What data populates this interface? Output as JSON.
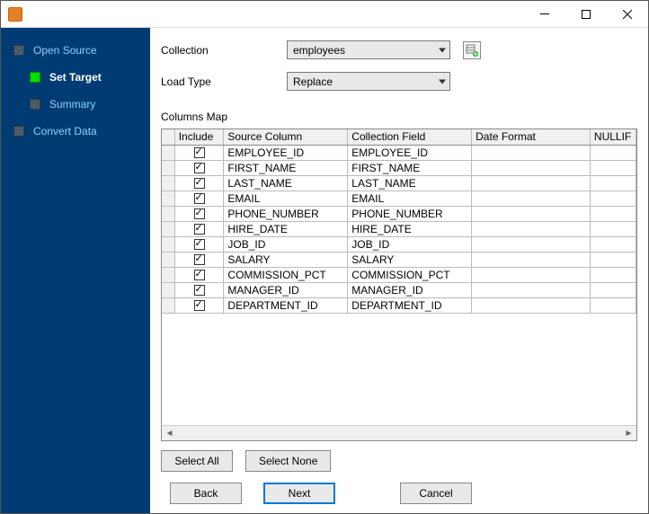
{
  "window": {
    "title": ""
  },
  "sidebar": {
    "steps": [
      {
        "label": "Open Source",
        "active": false,
        "sub": false
      },
      {
        "label": "Set Target",
        "active": true,
        "sub": true
      },
      {
        "label": "Summary",
        "active": false,
        "sub": true
      },
      {
        "label": "Convert Data",
        "active": false,
        "sub": false
      }
    ]
  },
  "form": {
    "collection_label": "Collection",
    "collection_value": "employees",
    "loadtype_label": "Load Type",
    "loadtype_value": "Replace",
    "columns_map_label": "Columns Map"
  },
  "grid": {
    "headers": {
      "rowhead": "",
      "include": "Include",
      "source": "Source Column",
      "field": "Collection Field",
      "date_format": "Date Format",
      "nullif": "NULLIF"
    },
    "rows": [
      {
        "include": true,
        "source": "EMPLOYEE_ID",
        "field": "EMPLOYEE_ID",
        "date_format": "",
        "nullif": ""
      },
      {
        "include": true,
        "source": "FIRST_NAME",
        "field": "FIRST_NAME",
        "date_format": "",
        "nullif": ""
      },
      {
        "include": true,
        "source": "LAST_NAME",
        "field": "LAST_NAME",
        "date_format": "",
        "nullif": ""
      },
      {
        "include": true,
        "source": "EMAIL",
        "field": "EMAIL",
        "date_format": "",
        "nullif": ""
      },
      {
        "include": true,
        "source": "PHONE_NUMBER",
        "field": "PHONE_NUMBER",
        "date_format": "",
        "nullif": ""
      },
      {
        "include": true,
        "source": "HIRE_DATE",
        "field": "HIRE_DATE",
        "date_format": "",
        "nullif": ""
      },
      {
        "include": true,
        "source": "JOB_ID",
        "field": "JOB_ID",
        "date_format": "",
        "nullif": ""
      },
      {
        "include": true,
        "source": "SALARY",
        "field": "SALARY",
        "date_format": "",
        "nullif": ""
      },
      {
        "include": true,
        "source": "COMMISSION_PCT",
        "field": "COMMISSION_PCT",
        "date_format": "",
        "nullif": ""
      },
      {
        "include": true,
        "source": "MANAGER_ID",
        "field": "MANAGER_ID",
        "date_format": "",
        "nullif": ""
      },
      {
        "include": true,
        "source": "DEPARTMENT_ID",
        "field": "DEPARTMENT_ID",
        "date_format": "",
        "nullif": ""
      }
    ]
  },
  "buttons": {
    "select_all": "Select All",
    "select_none": "Select None",
    "back": "Back",
    "next": "Next",
    "cancel": "Cancel"
  }
}
